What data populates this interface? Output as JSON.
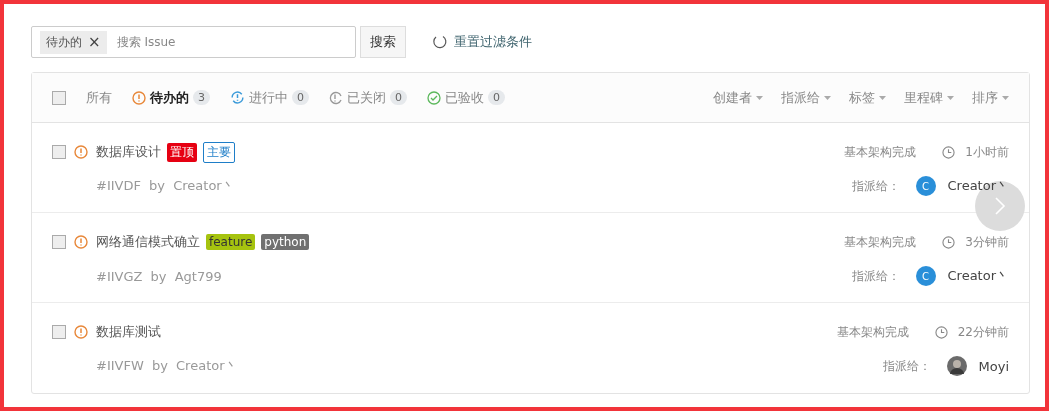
{
  "search": {
    "chip": "待办的",
    "chip_close": "×",
    "placeholder": "搜索 Issue",
    "button": "搜索",
    "reset": "重置过滤条件"
  },
  "select_all": {
    "checked": false
  },
  "tabs": [
    {
      "label": "所有",
      "selected": false
    },
    {
      "label": "待办的",
      "kind": "open",
      "count": "3",
      "selected": true
    },
    {
      "label": "进行中",
      "kind": "progress",
      "count": "0",
      "selected": false
    },
    {
      "label": "已关闭",
      "kind": "closed",
      "count": "0",
      "selected": false
    },
    {
      "label": "已验收",
      "kind": "accepted",
      "count": "0",
      "selected": false
    }
  ],
  "filters": [
    "创建者",
    "指派给",
    "标签",
    "里程碑",
    "排序"
  ],
  "issues": [
    {
      "title": "数据库设计",
      "checked": false,
      "tags": [
        {
          "text": "置顶",
          "kind": "solid",
          "color": "#e60012"
        },
        {
          "text": "主要",
          "kind": "outline",
          "color": "#1e7ec8"
        }
      ],
      "id": "#IIVDF",
      "by": "by",
      "author": "Creator丶",
      "milestone": "基本架构完成",
      "time": "1小时前",
      "assign_label": "指派给：",
      "assignee": {
        "kind": "letter",
        "letter": "C",
        "name": "Creator丶"
      }
    },
    {
      "title": "网络通信模式确立",
      "checked": false,
      "tags": [
        {
          "text": "feature",
          "kind": "solid",
          "color": "#a6c30f"
        },
        {
          "text": "python",
          "kind": "solid",
          "color": "#707070"
        }
      ],
      "id": "#IIVGZ",
      "by": "by",
      "author": "Agt799",
      "milestone": "基本架构完成",
      "time": "3分钟前",
      "assign_label": "指派给：",
      "assignee": {
        "kind": "letter",
        "letter": "C",
        "name": "Creator丶"
      }
    },
    {
      "title": "数据库测试",
      "checked": false,
      "id": "#IIVFW",
      "by": "by",
      "author": "Creator丶",
      "milestone": "基本架构完成",
      "time": "22分钟前",
      "assign_label": "指派给：",
      "assignee": {
        "name": "Moyi"
      }
    }
  ]
}
